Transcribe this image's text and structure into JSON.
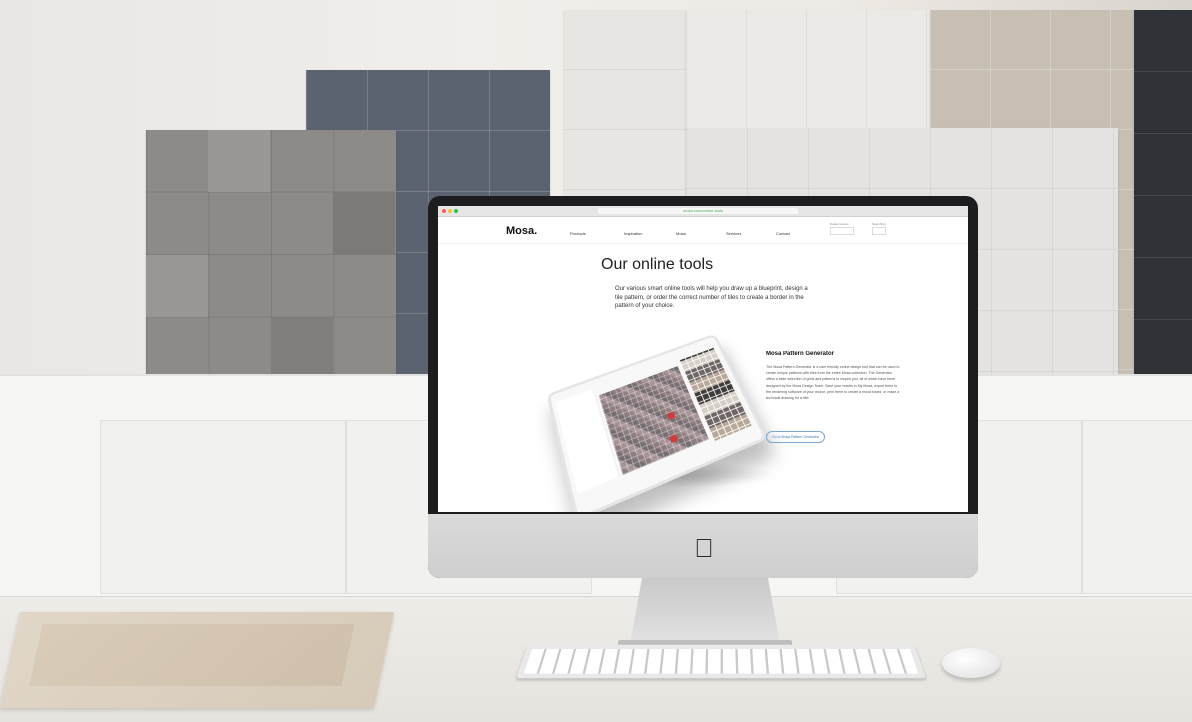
{
  "browser": {
    "url": "mosa.com/online-tools"
  },
  "site": {
    "brand": "Mosa.",
    "nav": [
      "Products",
      "Inspiration",
      "Mosa",
      "Services",
      "Contact"
    ],
    "utility": {
      "dealer_label": "Dealer locator",
      "search_label": "Searching"
    }
  },
  "hero": {
    "title": "Our online tools",
    "text": "Our various smart online tools will help you draw up a blueprint, design a tile pattern, or order the correct number of tiles to create a border in the pattern of your choice."
  },
  "tool": {
    "title": "Mosa Pattern Generator",
    "description": "The Mosa Pattern Generator is a user friendly online design tool that can be used to create unique patterns with tiles from the entire Mosa collection. The Generator offers a wide selection of grids and patterns to inspire you, all of which have been designed by the Mosa Design Team. Save your results in My Mosa, export them to the rendering software of your choice, print them to create a mood board, or make a technical drawing for a tiler.",
    "button": "Go to Mosa Pattern Generator"
  },
  "colors": {
    "accent": "#3b79bd",
    "highlight_tile": "#d33a3a"
  },
  "icons": [
    "apple-logo-icon",
    "close-dot-icon",
    "minimize-dot-icon",
    "zoom-dot-icon"
  ]
}
